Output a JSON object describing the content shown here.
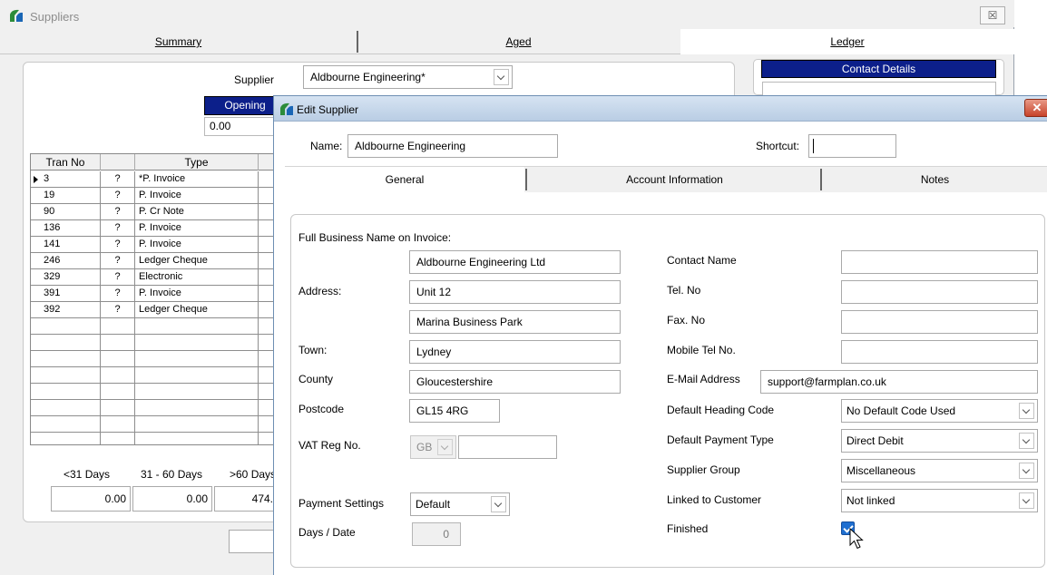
{
  "bg_window": {
    "title": "Suppliers",
    "close_glyph": "☒",
    "tabs": {
      "summary": "Summary",
      "aged": "Aged",
      "ledger": "Ledger"
    },
    "supplier_label": "Supplier",
    "supplier_value": "Aldbourne Engineering*",
    "opening_label": "Opening",
    "opening_value": "0.00",
    "contact_details_label": "Contact Details",
    "grid": {
      "headers": {
        "tran_no": "Tran No",
        "type": "Type"
      },
      "rows": [
        {
          "tran_no": "3",
          "q": "?",
          "type": "*P. Invoice"
        },
        {
          "tran_no": "19",
          "q": "?",
          "type": "P. Invoice"
        },
        {
          "tran_no": "90",
          "q": "?",
          "type": "P. Cr Note"
        },
        {
          "tran_no": "136",
          "q": "?",
          "type": "P. Invoice"
        },
        {
          "tran_no": "141",
          "q": "?",
          "type": "P. Invoice"
        },
        {
          "tran_no": "246",
          "q": "?",
          "type": "Ledger Cheque"
        },
        {
          "tran_no": "329",
          "q": "?",
          "type": "Electronic"
        },
        {
          "tran_no": "391",
          "q": "?",
          "type": "P. Invoice"
        },
        {
          "tran_no": "392",
          "q": "?",
          "type": "Ledger Cheque"
        }
      ]
    },
    "aging": {
      "labels": {
        "lt31": "<31 Days",
        "d31_60": "31 - 60 Days",
        "gt60": ">60 Days"
      },
      "values": {
        "lt31": "0.00",
        "d31_60": "0.00",
        "gt60": "474."
      }
    }
  },
  "dialog": {
    "title": "Edit Supplier",
    "close_glyph": "✕",
    "name_label": "Name:",
    "name_value": "Aldbourne Engineering",
    "shortcut_label": "Shortcut:",
    "shortcut_value": "",
    "tabs": {
      "general": "General",
      "account": "Account Information",
      "notes": "Notes"
    },
    "general": {
      "full_name_label": "Full Business Name on Invoice:",
      "address_line1": "Aldbourne Engineering Ltd",
      "address_label": "Address:",
      "address_line2": "Unit 12",
      "address_line3": "Marina Business Park",
      "town_label": "Town:",
      "town_value": "Lydney",
      "county_label": "County",
      "county_value": "Gloucestershire",
      "postcode_label": "Postcode",
      "postcode_value": "GL15 4RG",
      "vat_label": "VAT Reg No.",
      "vat_country": "GB",
      "vat_value": "",
      "payment_settings_label": "Payment Settings",
      "payment_settings_value": "Default",
      "days_date_label": "Days / Date",
      "days_date_value": "0",
      "contact_name_label": "Contact Name",
      "contact_name_value": "",
      "tel_label": "Tel. No",
      "tel_value": "",
      "fax_label": "Fax. No",
      "fax_value": "",
      "mobile_label": "Mobile Tel No.",
      "mobile_value": "",
      "email_label": "E-Mail Address",
      "email_value": "support@farmplan.co.uk",
      "heading_code_label": "Default Heading Code",
      "heading_code_value": "No Default Code Used",
      "payment_type_label": "Default Payment Type",
      "payment_type_value": "Direct Debit",
      "group_label": "Supplier Group",
      "group_value": "Miscellaneous",
      "linked_label": "Linked to Customer",
      "linked_value": "Not linked",
      "finished_label": "Finished",
      "finished_checked": true
    }
  },
  "colors": {
    "header_blue": "#0c1f8a",
    "checkbox_blue": "#1f6fd0"
  }
}
